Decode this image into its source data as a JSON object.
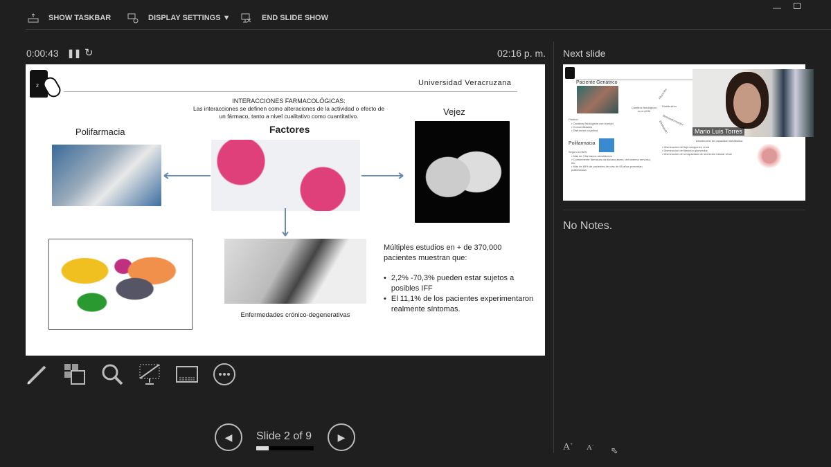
{
  "toolbar": {
    "show_taskbar": "SHOW TASKBAR",
    "display_settings": "DISPLAY SETTINGS ▼",
    "end_slide_show": "END SLIDE SHOW"
  },
  "timer": {
    "elapsed": "0:00:43",
    "clock": "02:16 p. m."
  },
  "slide": {
    "number": "2",
    "university": "Universidad Veracruzana",
    "heading": "INTERACCIONES FARMACOLÓGICAS:",
    "definition": "Las interacciones se definen como alteraciones de la actividad o efecto de un fármaco, tanto a nivel cualitativo como cuantitativo.",
    "polifarmacia": "Polifarmacia",
    "factores": "Factores",
    "vejez": "Vejez",
    "enfermedades": "Enfermedades crónico-degenerativas",
    "estudios": "Múltiples estudios en + de 370,000 pacientes muestran que:",
    "bullets": [
      "2,2% -70,3% pueden estar sujetos a posibles IFF",
      "El 11,1% de los pacientes experimentaron realmente síntomas."
    ]
  },
  "next_slide": {
    "label": "Next slide",
    "title": "Paciente Geriátrico",
    "center": "Cambios fisiológicos en el AOM",
    "branches": [
      "Absorción",
      "Distribución",
      "Biotransformación",
      "Eliminación"
    ],
    "padece": "Padece:",
    "padece_items": [
      "Cambios fisiológicos con la edad",
      "Comorbilidades",
      "Disfunción cognitiva"
    ],
    "polifarmacia": "Polifarmacia",
    "segun": "Según la OMS:",
    "poli_items": [
      "Más de 3 fármacos simultáneos",
      "Comúnmente fármacos cardiovasculares, del sistema nervioso, etc.",
      "Más de 85% de pacientes de más de 65 años presentan polifarmacia."
    ],
    "elim_items": [
      "Disminución de flujo sanguíneo renal",
      "Disminución de filtración glomerular",
      "Disminución de la capacidad de secreción tubular renal"
    ],
    "metab": "Disminución de capacidad metabólica."
  },
  "webcam": {
    "name": "Mario Luis Torres"
  },
  "notes": {
    "text": "No Notes."
  },
  "navigation": {
    "slide_counter": "Slide 2 of 9",
    "progress": 0.222
  },
  "icons": [
    "taskbar-icon",
    "display-settings-icon",
    "end-show-icon",
    "pause-icon",
    "restart-icon",
    "pen-icon",
    "see-all-slides-icon",
    "zoom-icon",
    "black-screen-icon",
    "subtitles-icon",
    "more-options-icon",
    "previous-icon",
    "next-icon",
    "font-increase-icon",
    "font-decrease-icon",
    "minimize-icon",
    "restore-icon"
  ]
}
